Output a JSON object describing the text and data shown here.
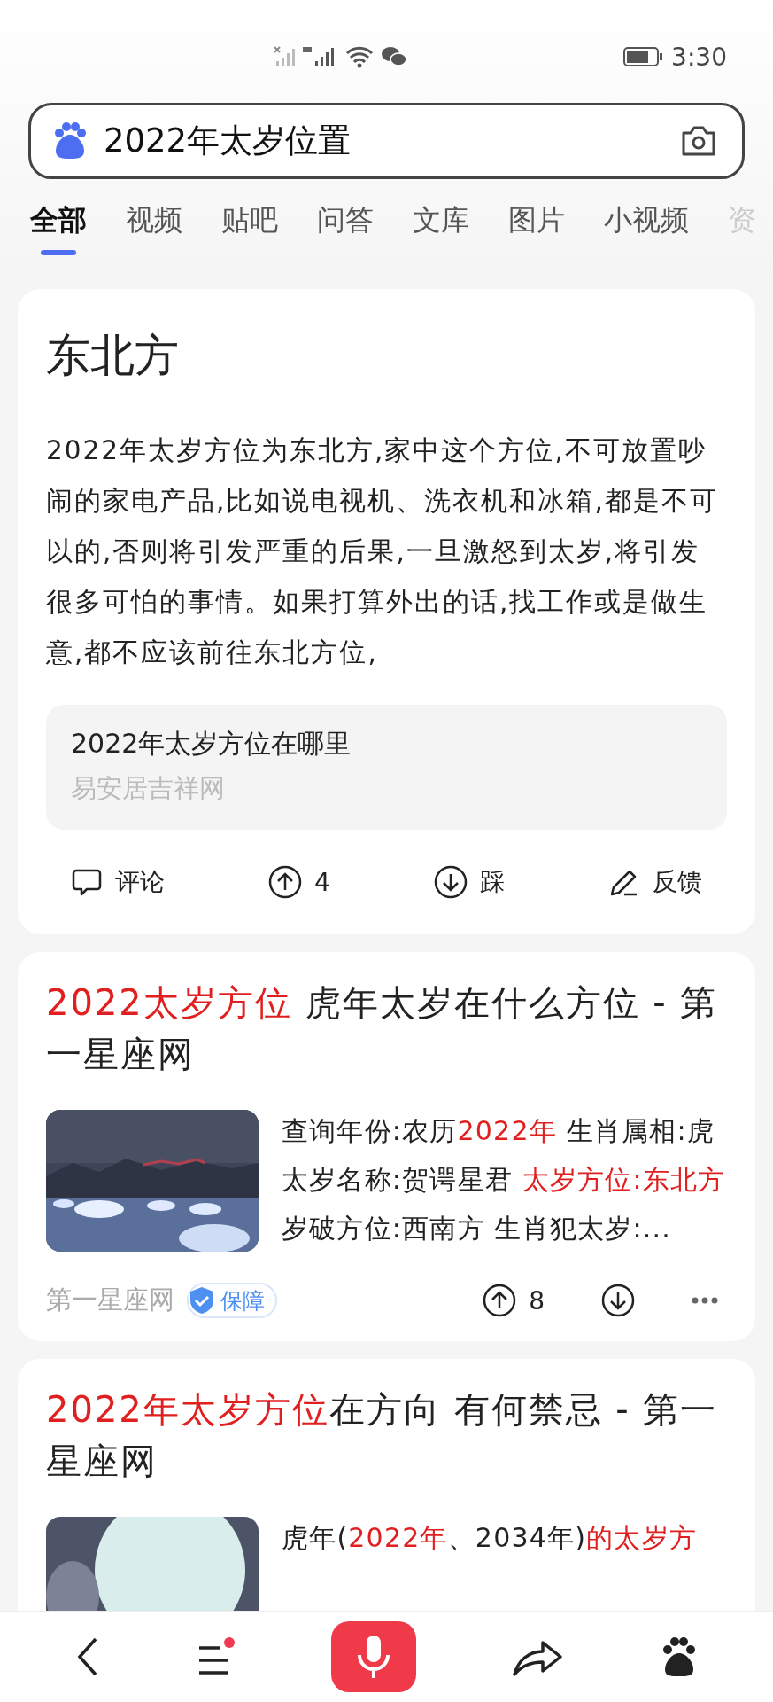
{
  "status_bar": {
    "time": "3:30"
  },
  "search": {
    "value": "2022年太岁位置"
  },
  "tabs": [
    {
      "label": "全部",
      "selected": true
    },
    {
      "label": "视频",
      "selected": false
    },
    {
      "label": "贴吧",
      "selected": false
    },
    {
      "label": "问答",
      "selected": false
    },
    {
      "label": "文库",
      "selected": false
    },
    {
      "label": "图片",
      "selected": false
    },
    {
      "label": "小视频",
      "selected": false
    },
    {
      "label": "资",
      "selected": false
    }
  ],
  "answer_card": {
    "heading": "东北方",
    "body": "2022年太岁方位为东北方,家中这个方位,不可放置吵闹的家电产品,比如说电视机、洗衣机和冰箱,都是不可以的,否则将引发严重的后果,一旦激怒到太岁,将引发很多可怕的事情。如果打算外出的话,找工作或是做生意,都不应该前往东北方位,",
    "source": {
      "title": "2022年太岁方位在哪里",
      "site": "易安居吉祥网"
    },
    "actions": [
      {
        "kind": "comment",
        "label": "评论"
      },
      {
        "kind": "up",
        "label": "4"
      },
      {
        "kind": "down",
        "label": "踩"
      },
      {
        "kind": "feedback",
        "label": "反馈"
      }
    ]
  },
  "results": [
    {
      "title": [
        {
          "text": "2022太岁方位",
          "highlight": true
        },
        {
          "text": " 虎年太岁在什么方位 - 第一星座网",
          "highlight": false
        }
      ],
      "thumbnail": {
        "kind": "picture"
      },
      "snippet": [
        {
          "text": "查询年份:农历",
          "highlight": false
        },
        {
          "text": "2022年",
          "highlight": true
        },
        {
          "text": " 生肖属相:虎太岁名称:贺谔星君 ",
          "highlight": false
        },
        {
          "text": "太岁方位:东北方",
          "highlight": true
        },
        {
          "text": " 岁破方位:西南方 生肖犯太岁:...",
          "highlight": false
        }
      ],
      "site": "第一星座网",
      "badge": "保障",
      "votes": "8"
    },
    {
      "title": [
        {
          "text": "2022年太岁方位",
          "highlight": true
        },
        {
          "text": "在方向 有何禁忌 - 第一星座网",
          "highlight": false
        }
      ],
      "thumbnail": {
        "kind": "picture"
      },
      "snippet": [
        {
          "text": "虎年(",
          "highlight": false
        },
        {
          "text": "2022年",
          "highlight": true
        },
        {
          "text": "、2034年)",
          "highlight": false
        },
        {
          "text": "的太岁方",
          "highlight": true
        }
      ]
    }
  ],
  "bottom_bar": {
    "menu_badge": true
  }
}
